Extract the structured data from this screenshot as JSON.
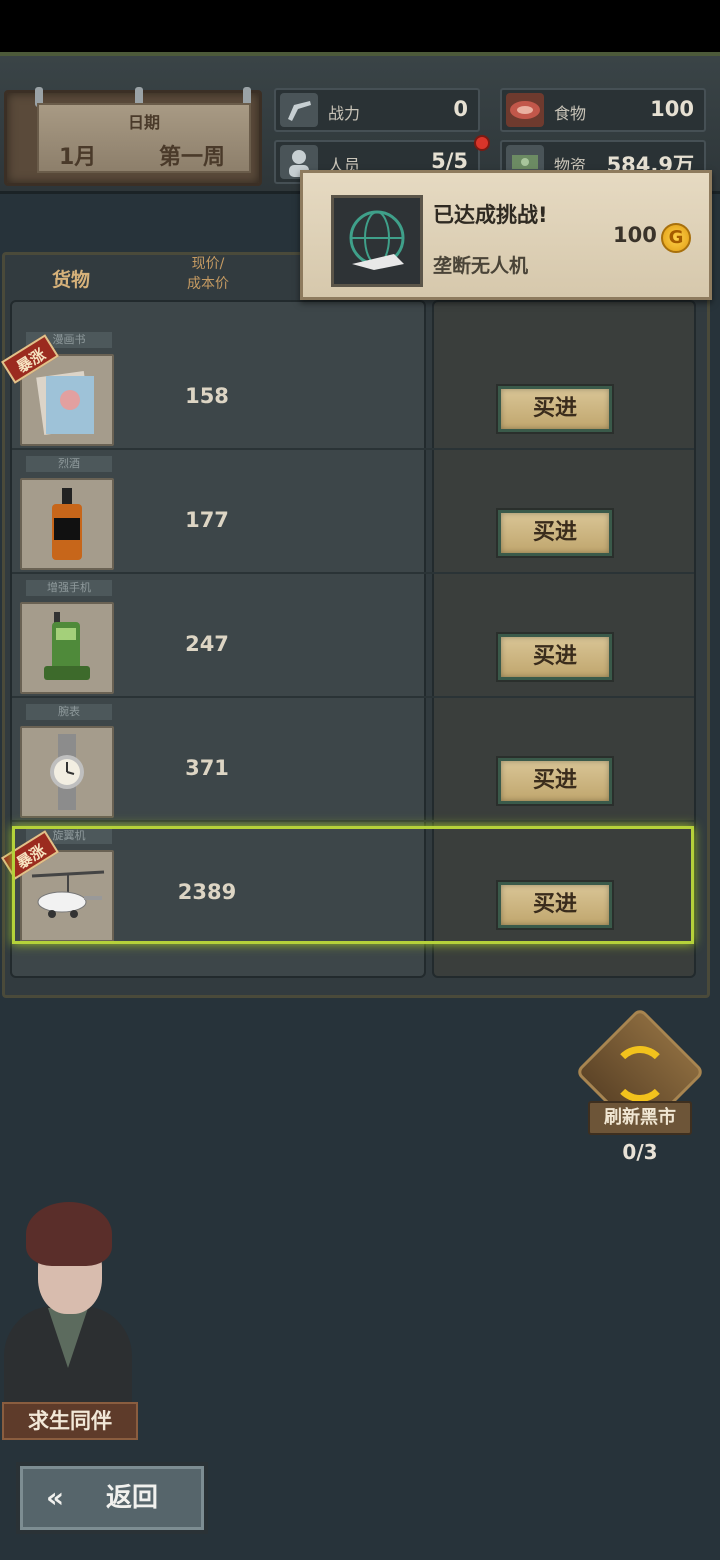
{
  "header": {
    "date_label": "日期",
    "month": "1月",
    "week": "第一周"
  },
  "stats": [
    {
      "label": "战力",
      "value": "0"
    },
    {
      "label": "食物",
      "value": "100"
    },
    {
      "label": "人员",
      "value": "5/5"
    },
    {
      "label": "物资",
      "value": "584.9万"
    }
  ],
  "columns": {
    "goods": "货物",
    "price": "现价/\n成本价"
  },
  "items": [
    {
      "tag": "漫画书",
      "price": "158",
      "hot": true,
      "hot_label": "暴涨",
      "buy": "买进"
    },
    {
      "tag": "烈酒",
      "price": "177",
      "hot": false,
      "hot_label": "",
      "buy": "买进"
    },
    {
      "tag": "增强手机",
      "price": "247",
      "hot": false,
      "hot_label": "",
      "buy": "买进"
    },
    {
      "tag": "腕表",
      "price": "371",
      "hot": false,
      "hot_label": "",
      "buy": "买进"
    },
    {
      "tag": "旋翼机",
      "price": "2389",
      "hot": true,
      "hot_label": "暴涨",
      "buy": "买进"
    }
  ],
  "achievement": {
    "title": "已达成挑战!",
    "name": "垄断无人机",
    "reward": "100",
    "coin": "G"
  },
  "refresh": {
    "label": "刷新黑市",
    "count": "0/3"
  },
  "companion_label": "求生同伴",
  "back_label": "返回",
  "colors": {
    "background": "#27333a",
    "highlight": "#b5d23a",
    "hot_badge": "#9b2b1f"
  }
}
